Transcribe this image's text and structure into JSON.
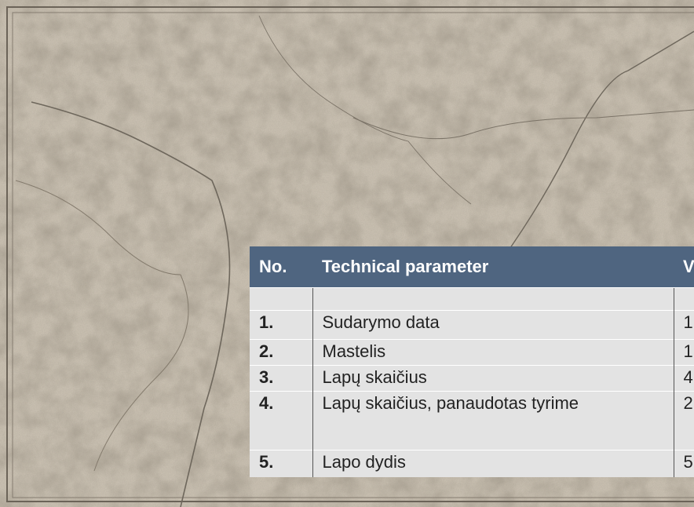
{
  "table": {
    "headers": [
      "No.",
      "Technical parameter",
      "V"
    ],
    "rows": [
      {
        "no": "1.",
        "param": "Sudarymo data",
        "value": "1"
      },
      {
        "no": "2.",
        "param": "Mastelis",
        "value": "1"
      },
      {
        "no": "3.",
        "param": "Lapų skaičius",
        "value": "4"
      },
      {
        "no": "4.",
        "param": "Lapų skaičius, panaudotas tyrime",
        "value": "2"
      },
      {
        "no": "5.",
        "param": "Lapo dydis",
        "value": "5"
      }
    ]
  },
  "colors": {
    "map_paper": "#c9c0b1",
    "header_bg": "#4f6580",
    "cell_bg": "#e3e3e3"
  }
}
